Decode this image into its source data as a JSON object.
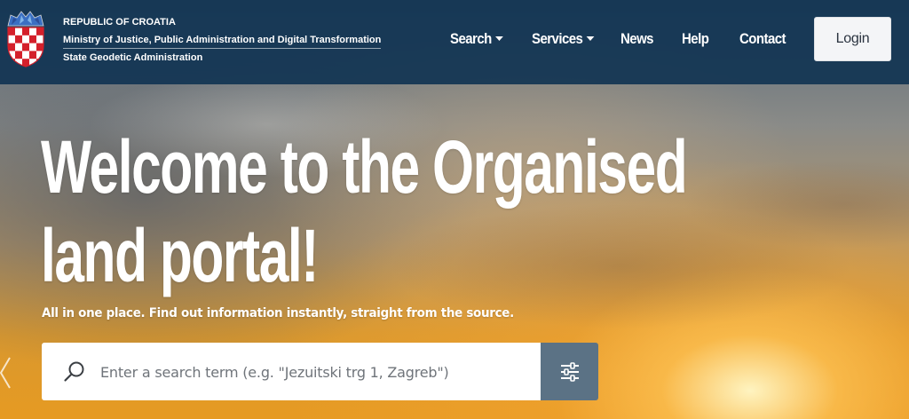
{
  "header": {
    "org_line1": "REPUBLIC OF CROATIA",
    "org_line2": "Ministry of Justice, Public Administration and Digital Transformation",
    "org_line3": "State Geodetic Administration"
  },
  "nav": {
    "search": "Search",
    "services": "Services",
    "news": "News",
    "help": "Help",
    "contact": "Contact",
    "login": "Login"
  },
  "hero": {
    "title_line1": "Welcome to the Organised",
    "title_line2": "land portal!",
    "subtitle": "All in one place. Find out information instantly, straight from the source."
  },
  "search": {
    "placeholder": "Enter a search term (e.g. \"Jezuitski trg 1, Zagreb\")",
    "value": ""
  },
  "icons": {
    "logo": "croatian-coat-of-arms",
    "search": "search-icon",
    "filter": "sliders-icon",
    "prev": "chevron-left-icon"
  },
  "colors": {
    "topbar": "#113452",
    "filter_button": "#5b7285",
    "login_bg": "#f4f5f7"
  }
}
